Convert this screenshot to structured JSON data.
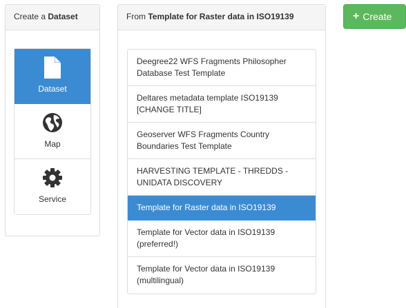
{
  "type_panel": {
    "heading_prefix": "Create a",
    "heading_bold": "Dataset",
    "items": [
      {
        "label": "Dataset",
        "icon": "file-icon",
        "active": true
      },
      {
        "label": "Map",
        "icon": "globe-icon",
        "active": false
      },
      {
        "label": "Service",
        "icon": "gear-icon",
        "active": false
      }
    ]
  },
  "template_panel": {
    "heading_prefix": "From",
    "heading_bold": "Template for Raster data in ISO19139",
    "items": [
      {
        "line1": "Deegree22 WFS Fragments Philosopher",
        "line2": "Database Test Template",
        "active": false
      },
      {
        "line1": "Deltares metadata template ISO19139",
        "line2": "[CHANGE TITLE]",
        "active": false
      },
      {
        "line1": "Geoserver WFS Fragments Country",
        "line2": "Boundaries Test Template",
        "active": false
      },
      {
        "line1": "HARVESTING TEMPLATE - THREDDS -",
        "line2": "UNIDATA DISCOVERY",
        "active": false
      },
      {
        "line1": "Template for Raster data in ISO19139",
        "line2": "",
        "active": true
      },
      {
        "line1": "Template for Vector data in ISO19139",
        "line2": "(preferred!)",
        "active": false
      },
      {
        "line1": "Template for Vector data in ISO19139",
        "line2": "(multilingual)",
        "active": false
      }
    ]
  },
  "create_button": {
    "icon": "plus-icon",
    "label": "Create",
    "color": "#5cb85c"
  },
  "colors": {
    "active": "#3b8bd3",
    "border": "#dddddd",
    "heading_bg": "#f5f5f5"
  }
}
